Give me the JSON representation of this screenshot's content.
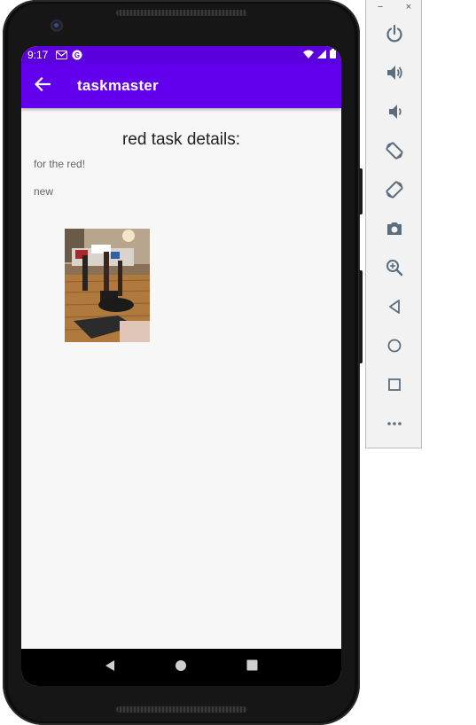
{
  "status_bar": {
    "time": "9:17",
    "icons": [
      "gmail-icon",
      "app-notification-icon",
      "wifi-icon",
      "cell-signal-icon",
      "battery-icon"
    ]
  },
  "app_bar": {
    "title": "taskmaster",
    "back_icon": "arrow-back-icon"
  },
  "task": {
    "title": "red task details:",
    "body": "for the red!",
    "state": "new",
    "image": "task-photo"
  },
  "nav_bar": {
    "buttons": [
      "back-triangle-icon",
      "home-circle-icon",
      "recents-square-icon"
    ]
  },
  "emulator": {
    "window_buttons": [
      "−",
      "×"
    ],
    "tools": [
      "power-icon",
      "volume-up-icon",
      "volume-down-icon",
      "rotate-left-icon",
      "rotate-right-icon",
      "camera-icon",
      "zoom-icon",
      "back-icon",
      "home-icon",
      "overview-icon",
      "more-icon"
    ]
  },
  "colors": {
    "app_bar": "#6200ee",
    "status_bar": "#5b00dd",
    "background": "#f7f7f7"
  }
}
